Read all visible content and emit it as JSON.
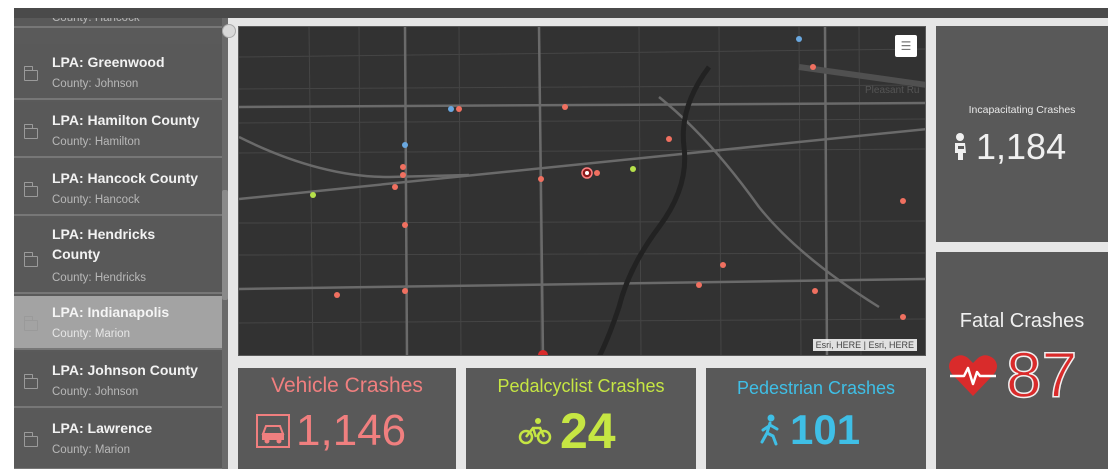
{
  "sidebar": {
    "items": [
      {
        "title": "",
        "sub": "County: Hancock"
      },
      {
        "title": "LPA: Greenwood",
        "sub": "County: Johnson"
      },
      {
        "title": "LPA: Hamilton County",
        "sub": "County: Hamilton"
      },
      {
        "title": "LPA: Hancock County",
        "sub": "County: Hancock"
      },
      {
        "title": "LPA: Hendricks County",
        "sub": "County: Hendricks"
      },
      {
        "title": "LPA: Indianapolis",
        "sub": "County: Marion"
      },
      {
        "title": "LPA: Johnson County",
        "sub": "County: Johnson"
      },
      {
        "title": "LPA: Lawrence",
        "sub": "County: Marion"
      }
    ],
    "selected_index": 5
  },
  "left_mark": "ı",
  "map": {
    "attribution": "Esri, HERE | Esri, HERE",
    "street_label": "Pleasant Ru",
    "legend_icon": "list-icon"
  },
  "stats": {
    "vehicle": {
      "label": "Vehicle Crashes",
      "value": "1,146",
      "icon": "car-icon",
      "color": "#f07f7f"
    },
    "pedalcyclist": {
      "label": "Pedalcyclist Crashes",
      "value": "24",
      "icon": "bicycle-icon",
      "color": "#c6e643"
    },
    "pedestrian": {
      "label": "Pedestrian Crashes",
      "value": "101",
      "icon": "walking-person-icon",
      "color": "#3fbfe6"
    },
    "incapacitating": {
      "label": "Incapacitating Crashes",
      "value": "1,184",
      "icon": "injured-person-icon",
      "color": "#f0f0f0"
    },
    "fatal": {
      "label": "Fatal Crashes",
      "value": "87",
      "icon": "heartbeat-icon",
      "color": "#d92b2b"
    }
  },
  "colors": {
    "panel": "#595959",
    "map_bg": "#323232",
    "crash_point_red": "#f07060",
    "crash_point_blue": "#6aa8e0",
    "crash_point_green": "#b6e04a"
  }
}
